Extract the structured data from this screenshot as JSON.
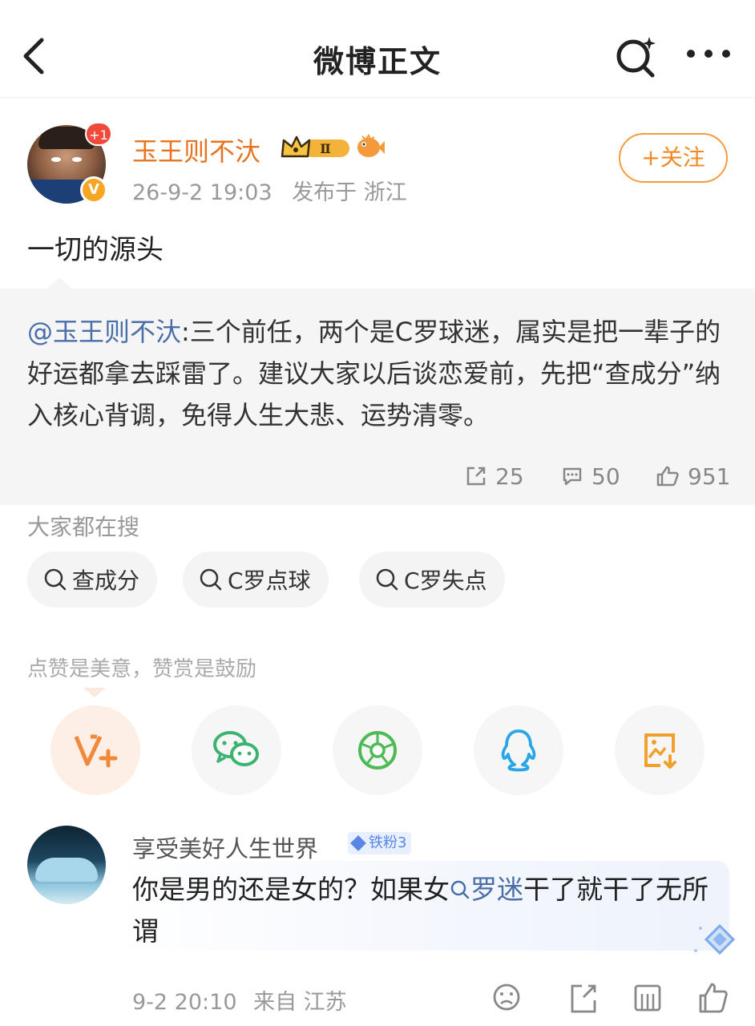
{
  "nav": {
    "title": "微博正文"
  },
  "author": {
    "name": "玉王则不汏",
    "notification_badge": "+1",
    "verified_mark": "V",
    "level_badge": "Ⅱ",
    "time": "26-9-2 19:03",
    "location": "发布于 浙江",
    "follow_label": "+关注"
  },
  "post": {
    "text": "一切的源头"
  },
  "quote": {
    "mention": "@玉王则不汏",
    "text": ":三个前任，两个是C罗球迷，属实是把一辈子的好运都拿去踩雷了。建议大家以后谈恋爱前，先把“查成分”纳入核心背调，免得人生大悲、运势清零。",
    "reposts": "25",
    "comments": "50",
    "likes": "951"
  },
  "search": {
    "title": "大家都在搜",
    "chips": [
      "查成分",
      "C罗点球",
      "C罗失点"
    ]
  },
  "reward": {
    "title": "点赞是美意，赞赏是鼓励",
    "share_icons": [
      "v-plus-reward-icon",
      "wechat-icon",
      "moments-icon",
      "qq-icon",
      "save-image-icon"
    ]
  },
  "comment": {
    "name": "享受美好人生世界",
    "fan_badge": "铁粉3",
    "text_before": "你是男的还是女的？如果女",
    "topic": "罗迷",
    "text_after": "干了就干了无所谓",
    "time": "9-2 20:10",
    "location": "来自 江苏"
  },
  "colors": {
    "accent_orange": "#e8731f",
    "link_blue": "#4a6ea8",
    "quote_bg": "#f5f5f5",
    "badge_red": "#f04a3a"
  }
}
